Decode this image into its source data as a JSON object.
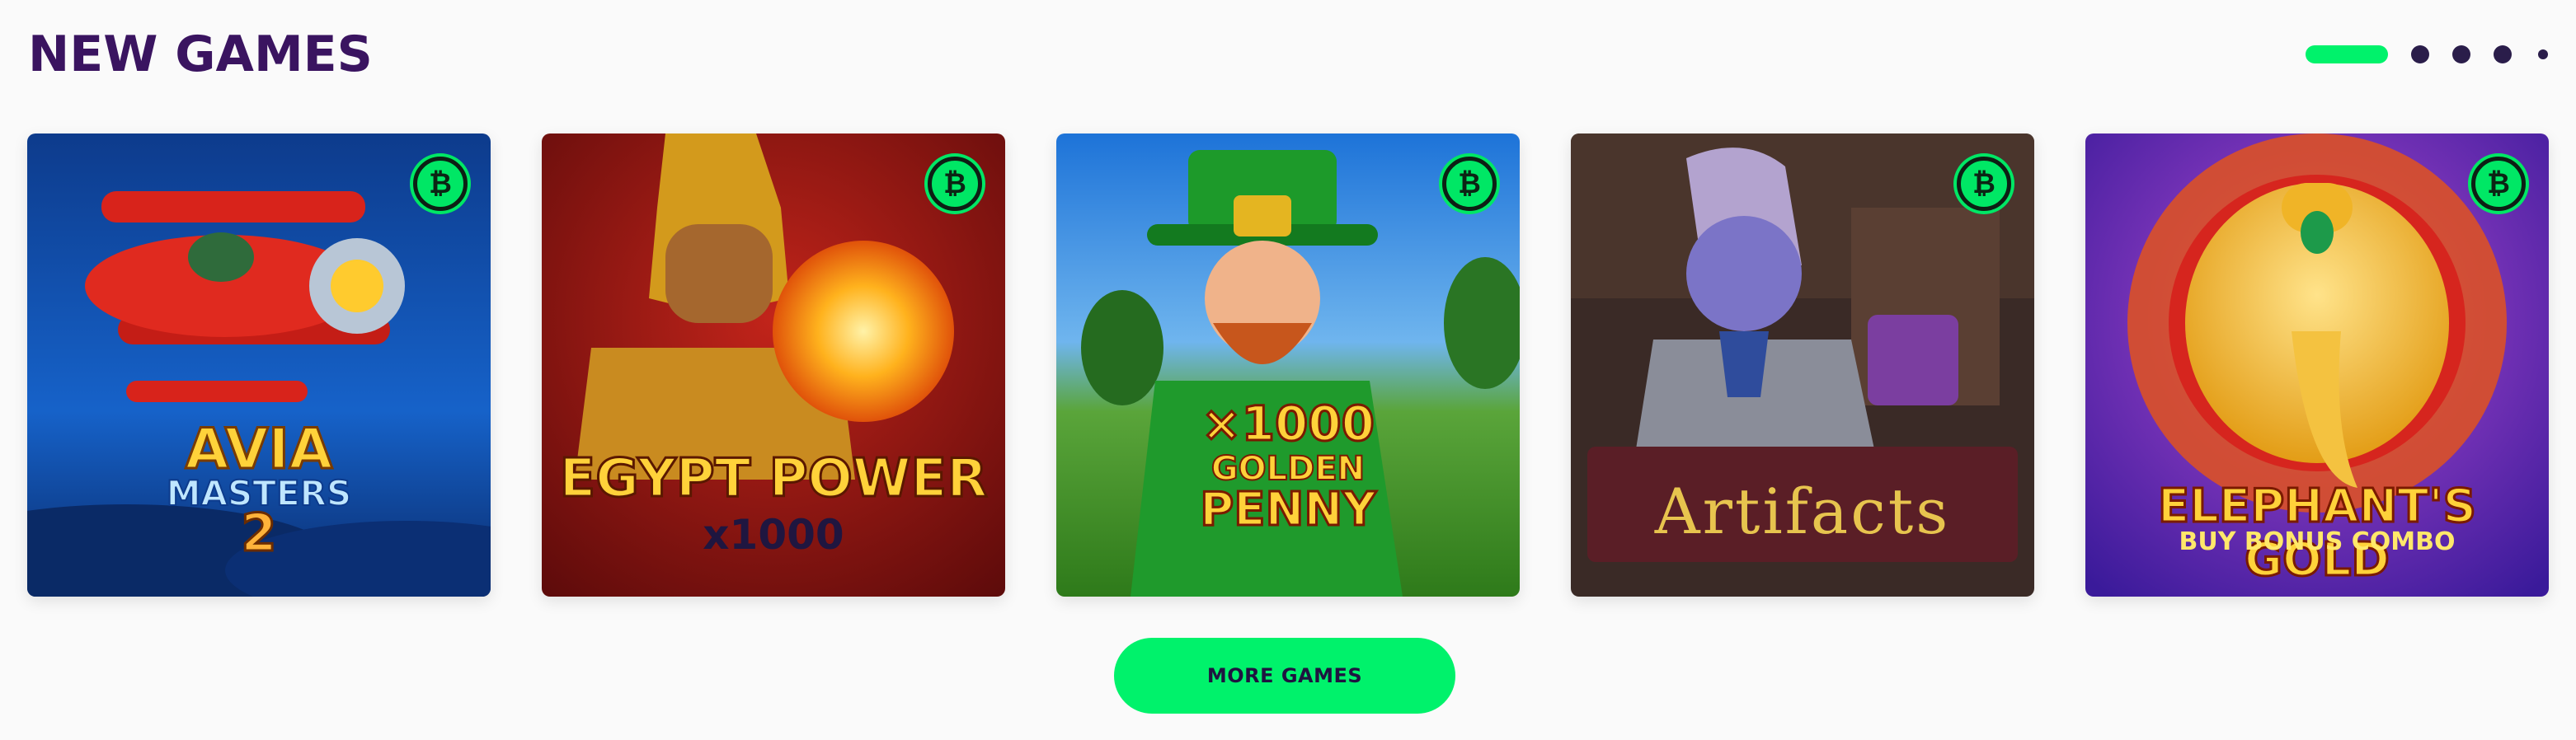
{
  "section": {
    "title": "NEW GAMES",
    "more_label": "MORE GAMES"
  },
  "pager": {
    "pages": 5,
    "active": 1
  },
  "colors": {
    "accent": "#00f26b",
    "title": "#3a1460",
    "dot": "#2a1d4a"
  },
  "games": [
    {
      "title_line1": "AVIA",
      "title_line2": "MASTERS",
      "title_line3": "2",
      "badge_icon": "bitcoin-icon",
      "badge_glyph": "₿"
    },
    {
      "title_line1": "EGYPT POWER",
      "title_line2": "x1000",
      "badge_icon": "bitcoin-icon",
      "badge_glyph": "₿"
    },
    {
      "title_line1": "×1000",
      "title_line2": "GOLDEN",
      "title_line3": "PENNY",
      "badge_icon": "bitcoin-icon",
      "badge_glyph": "₿"
    },
    {
      "title_line1": "Artifacts",
      "badge_icon": "bitcoin-icon",
      "badge_glyph": "₿"
    },
    {
      "title_line1": "ELEPHANT'S GOLD",
      "title_line2": "BUY BONUS COMBO",
      "badge_icon": "bitcoin-icon",
      "badge_glyph": "₿"
    }
  ]
}
